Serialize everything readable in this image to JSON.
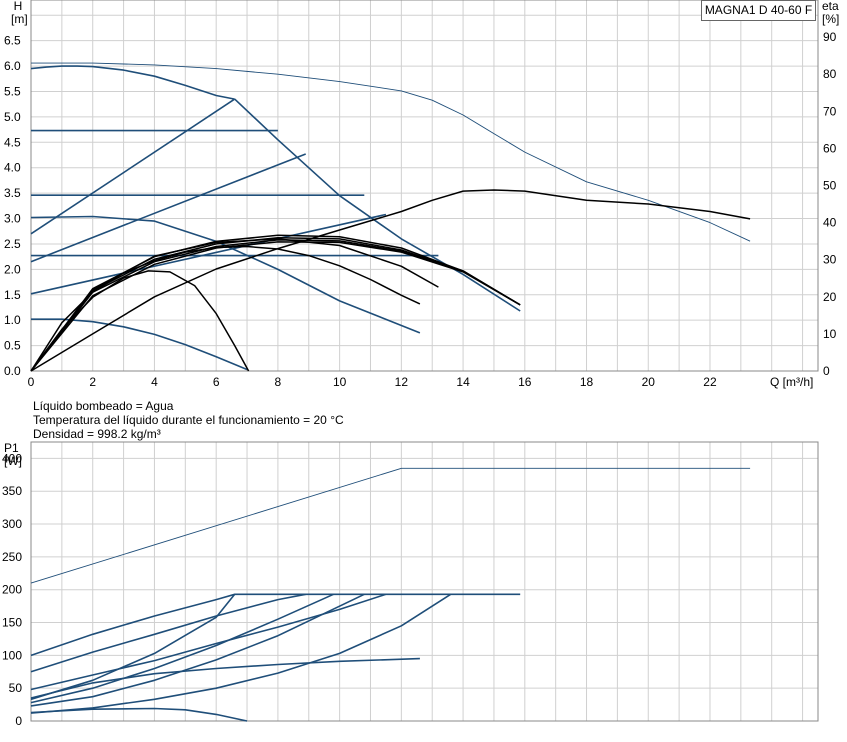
{
  "model": "MAGNA1 D 40-60 F",
  "info_lines": [
    "Líquido bombeado = Agua",
    "Temperatura del líquido durante el funcionamiento = 20 °C",
    "Densidad = 998.2 kg/m³"
  ],
  "chart_data": [
    {
      "type": "line",
      "title": "",
      "xlabel": "Q [m³/h]",
      "ylabel": "H [m]",
      "y2label": "eta [%]",
      "xlim": [
        0,
        25.5
      ],
      "ylim": [
        0,
        7.3
      ],
      "y2lim": [
        0,
        100
      ],
      "x_ticks": [
        0,
        2,
        4,
        6,
        8,
        10,
        12,
        14,
        16,
        18,
        20,
        22
      ],
      "y_ticks": [
        "0.0",
        "0.5",
        "1.0",
        "1.5",
        "2.0",
        "2.5",
        "3.0",
        "3.5",
        "4.0",
        "4.5",
        "5.0",
        "5.5",
        "6.0",
        "6.5"
      ],
      "y2_ticks": [
        0,
        10,
        20,
        30,
        40,
        50,
        60,
        70,
        80,
        90
      ],
      "grid": true,
      "series": [
        {
          "axis": "y",
          "color": "#1f4e79",
          "x": [
            0,
            0.5,
            1,
            1.5,
            2,
            3,
            4,
            5,
            6,
            6.6
          ],
          "y": [
            5.95,
            5.98,
            6.0,
            6.0,
            5.99,
            5.92,
            5.8,
            5.62,
            5.42,
            5.35
          ]
        },
        {
          "axis": "y",
          "color": "#1f4e79",
          "x": [
            6.6,
            8,
            10,
            12,
            14,
            15.85
          ],
          "y": [
            5.35,
            4.55,
            3.45,
            2.6,
            1.9,
            1.18
          ]
        },
        {
          "axis": "y",
          "color": "#1f4e79",
          "x": [
            0,
            8
          ],
          "y": [
            4.73,
            4.73
          ]
        },
        {
          "axis": "y",
          "color": "#1f4e79",
          "x": [
            0,
            10.8
          ],
          "y": [
            3.46,
            3.46
          ]
        },
        {
          "axis": "y",
          "color": "#1f4e79",
          "x": [
            0,
            13.2
          ],
          "y": [
            2.27,
            2.27
          ]
        },
        {
          "axis": "y",
          "color": "#1f4e79",
          "x": [
            0,
            6.6
          ],
          "y": [
            2.7,
            5.35
          ]
        },
        {
          "axis": "y",
          "color": "#1f4e79",
          "x": [
            0,
            8.9
          ],
          "y": [
            2.15,
            4.27
          ]
        },
        {
          "axis": "y",
          "color": "#1f4e79",
          "x": [
            0,
            11.5
          ],
          "y": [
            1.52,
            3.08
          ]
        },
        {
          "axis": "y",
          "color": "#1f4e79",
          "x": [
            0,
            2,
            4,
            6,
            8,
            10,
            12.6
          ],
          "y": [
            3.02,
            3.04,
            2.95,
            2.55,
            2.0,
            1.38,
            0.75
          ]
        },
        {
          "axis": "y",
          "color": "#1f4e79",
          "x": [
            0,
            1,
            2,
            3,
            4,
            5,
            6,
            7
          ],
          "y": [
            1.02,
            1.02,
            0.97,
            0.87,
            0.72,
            0.52,
            0.28,
            0.03
          ]
        },
        {
          "axis": "y2",
          "color": "#1f4e79",
          "x": [
            0,
            2,
            4,
            6,
            8,
            10,
            12,
            13,
            14,
            15,
            16,
            18,
            20,
            22,
            23.3
          ],
          "y": [
            83,
            83,
            82.5,
            81.5,
            80,
            78,
            75.5,
            73,
            69,
            64,
            59,
            51,
            46,
            40,
            35
          ]
        },
        {
          "axis": "y2",
          "color": "#000000",
          "x": [
            0,
            2,
            4,
            6,
            8,
            10,
            12,
            13,
            14,
            15,
            16,
            18,
            20,
            22,
            23.3
          ],
          "y": [
            0,
            10,
            20,
            27.5,
            33,
            38,
            43,
            46,
            48.5,
            48.8,
            48.5,
            46,
            45,
            43,
            41
          ]
        },
        {
          "axis": "y",
          "color": "#000000",
          "x": [
            0,
            1,
            2,
            3,
            3.8,
            4.5,
            5.3,
            6,
            6.6,
            7.05
          ],
          "y": [
            0,
            0.82,
            1.45,
            1.83,
            1.97,
            1.95,
            1.68,
            1.13,
            0.5,
            0.0
          ]
        },
        {
          "axis": "y",
          "color": "#000000",
          "x": [
            0,
            1,
            2,
            3,
            4,
            5,
            6,
            7,
            8,
            9,
            10,
            11,
            12,
            12.6
          ],
          "y": [
            0,
            0.95,
            1.55,
            1.93,
            2.17,
            2.34,
            2.43,
            2.45,
            2.4,
            2.27,
            2.07,
            1.8,
            1.49,
            1.32
          ]
        },
        {
          "axis": "y",
          "color": "#000000",
          "x": [
            0,
            2,
            4,
            6,
            8,
            10,
            12,
            13.2
          ],
          "y": [
            0,
            1.6,
            2.26,
            2.53,
            2.6,
            2.47,
            2.06,
            1.65
          ]
        },
        {
          "axis": "y",
          "color": "#000000",
          "x": [
            0,
            2,
            4,
            6,
            8,
            10,
            12,
            14,
            15.85
          ],
          "y": [
            0,
            1.58,
            2.2,
            2.5,
            2.62,
            2.6,
            2.38,
            1.97,
            1.3
          ]
        },
        {
          "axis": "y",
          "color": "#000000",
          "x": [
            0,
            2,
            4,
            6,
            8,
            10,
            12,
            14,
            15.85
          ],
          "y": [
            0,
            1.62,
            2.25,
            2.55,
            2.67,
            2.64,
            2.42,
            1.97,
            1.3
          ]
        },
        {
          "axis": "y",
          "color": "#000000",
          "x": [
            0,
            2,
            4,
            6,
            8,
            10,
            12,
            14,
            15.85
          ],
          "y": [
            0,
            1.55,
            2.15,
            2.45,
            2.58,
            2.56,
            2.36,
            1.96,
            1.3
          ]
        },
        {
          "axis": "y",
          "color": "#000000",
          "x": [
            0,
            2,
            4,
            6,
            8,
            10,
            12,
            14,
            15.85
          ],
          "y": [
            0,
            1.48,
            2.1,
            2.42,
            2.54,
            2.53,
            2.34,
            1.95,
            1.3
          ]
        }
      ]
    },
    {
      "type": "line",
      "title": "",
      "xlabel": "",
      "ylabel": "P1 [W]",
      "xlim": [
        0,
        25.5
      ],
      "ylim": [
        0,
        425
      ],
      "y_ticks": [
        0,
        50,
        100,
        150,
        200,
        250,
        300,
        350,
        400
      ],
      "grid": true,
      "series": [
        {
          "color": "#1f4e79",
          "x": [
            0,
            12,
            23.3
          ],
          "y": [
            210,
            385,
            385
          ]
        },
        {
          "color": "#1f4e79",
          "x": [
            0,
            2,
            4,
            6,
            6.6,
            15.85
          ],
          "y": [
            100,
            132,
            160,
            185,
            193,
            193
          ]
        },
        {
          "color": "#1f4e79",
          "x": [
            0,
            2,
            4,
            6,
            8,
            8.9
          ],
          "y": [
            75,
            105,
            132,
            160,
            185,
            193
          ]
        },
        {
          "color": "#1f4e79",
          "x": [
            0,
            2,
            4,
            6,
            8,
            10,
            11.5
          ],
          "y": [
            48,
            70,
            92,
            118,
            143,
            170,
            193
          ]
        },
        {
          "color": "#1f4e79",
          "x": [
            0,
            2,
            4,
            6,
            8,
            10,
            12,
            13.6
          ],
          "y": [
            12,
            20,
            33,
            50,
            73,
            103,
            145,
            193
          ]
        },
        {
          "color": "#1f4e79",
          "x": [
            0,
            2,
            4,
            6,
            8,
            10.8
          ],
          "y": [
            23,
            37,
            62,
            93,
            130,
            193
          ]
        },
        {
          "color": "#1f4e79",
          "x": [
            0,
            2,
            4,
            6,
            8,
            9.8
          ],
          "y": [
            28,
            50,
            80,
            115,
            155,
            193
          ]
        },
        {
          "color": "#1f4e79",
          "x": [
            0,
            2,
            4,
            6,
            6.6
          ],
          "y": [
            33,
            62,
            103,
            158,
            193
          ]
        },
        {
          "color": "#1f4e79",
          "x": [
            0,
            2,
            4,
            6,
            8,
            10,
            12.6
          ],
          "y": [
            35,
            58,
            72,
            80,
            86,
            91,
            95
          ]
        },
        {
          "color": "#1f4e79",
          "x": [
            0,
            2,
            4,
            5,
            6,
            7
          ],
          "y": [
            13,
            18,
            19,
            17,
            10,
            0
          ]
        }
      ]
    }
  ]
}
